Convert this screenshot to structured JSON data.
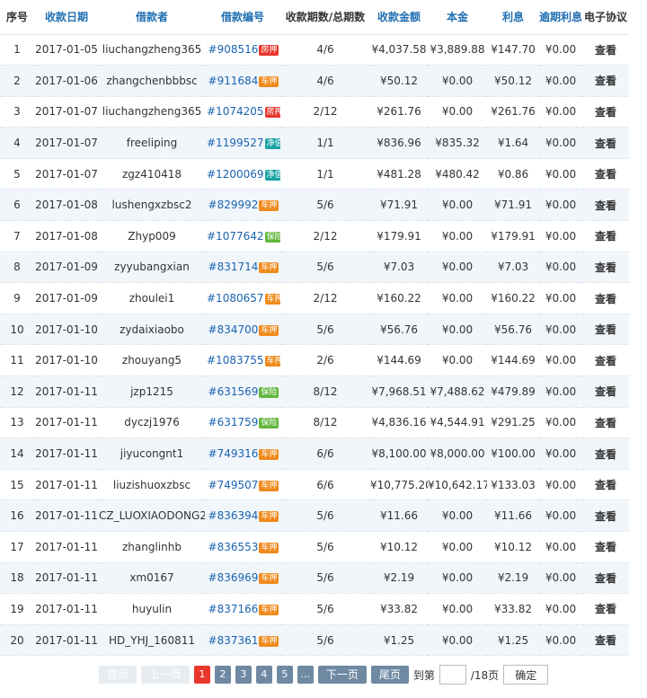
{
  "columns": [
    "序号",
    "收款日期",
    "借款者",
    "借款编号",
    "收款期数/总期数",
    "收款金额",
    "本金",
    "利息",
    "逾期利息",
    "电子协议"
  ],
  "colors": {
    "link_blue": "#1a63b0",
    "period_red": "#c0392b",
    "badge_car": "#f08a1c",
    "badge_house": "#e8382e",
    "badge_net": "#17a2a3",
    "badge_guarantee": "#62b63c"
  },
  "rows": [
    {
      "no": "1",
      "date": "2017-01-05",
      "user": "liuchangzheng365",
      "code": "#908516",
      "badge": "房押",
      "badge_color": "#e8382e",
      "period": "4/6",
      "amount": "¥4,037.58",
      "principal": "¥3,889.88",
      "interest": "¥147.70",
      "overdue": "¥0.00",
      "view": "查看"
    },
    {
      "no": "2",
      "date": "2017-01-06",
      "user": "zhangchenbbbsc",
      "code": "#911684",
      "badge": "车押",
      "badge_color": "#f08a1c",
      "period": "4/6",
      "amount": "¥50.12",
      "principal": "¥0.00",
      "interest": "¥50.12",
      "overdue": "¥0.00",
      "view": "查看"
    },
    {
      "no": "3",
      "date": "2017-01-07",
      "user": "liuchangzheng365",
      "code": "#1074205",
      "badge": "房押",
      "badge_color": "#e8382e",
      "period": "2/12",
      "amount": "¥261.76",
      "principal": "¥0.00",
      "interest": "¥261.76",
      "overdue": "¥0.00",
      "view": "查看"
    },
    {
      "no": "4",
      "date": "2017-01-07",
      "user": "freeliping",
      "code": "#1199527",
      "badge": "净值",
      "badge_color": "#17a2a3",
      "period": "1/1",
      "amount": "¥836.96",
      "principal": "¥835.32",
      "interest": "¥1.64",
      "overdue": "¥0.00",
      "view": "查看"
    },
    {
      "no": "5",
      "date": "2017-01-07",
      "user": "zgz410418",
      "code": "#1200069",
      "badge": "净值",
      "badge_color": "#17a2a3",
      "period": "1/1",
      "amount": "¥481.28",
      "principal": "¥480.42",
      "interest": "¥0.86",
      "overdue": "¥0.00",
      "view": "查看"
    },
    {
      "no": "6",
      "date": "2017-01-08",
      "user": "lushengxzbsc2",
      "code": "#829992",
      "badge": "车押",
      "badge_color": "#f08a1c",
      "period": "5/6",
      "amount": "¥71.91",
      "principal": "¥0.00",
      "interest": "¥71.91",
      "overdue": "¥0.00",
      "view": "查看"
    },
    {
      "no": "7",
      "date": "2017-01-08",
      "user": "Zhyp009",
      "code": "#1077642",
      "badge": "保险",
      "badge_color": "#62b63c",
      "period": "2/12",
      "amount": "¥179.91",
      "principal": "¥0.00",
      "interest": "¥179.91",
      "overdue": "¥0.00",
      "view": "查看"
    },
    {
      "no": "8",
      "date": "2017-01-09",
      "user": "zyyubangxian",
      "code": "#831714",
      "badge": "车押",
      "badge_color": "#f08a1c",
      "period": "5/6",
      "amount": "¥7.03",
      "principal": "¥0.00",
      "interest": "¥7.03",
      "overdue": "¥0.00",
      "view": "查看"
    },
    {
      "no": "9",
      "date": "2017-01-09",
      "user": "zhoulei1",
      "code": "#1080657",
      "badge": "车押",
      "badge_color": "#f08a1c",
      "period": "2/12",
      "amount": "¥160.22",
      "principal": "¥0.00",
      "interest": "¥160.22",
      "overdue": "¥0.00",
      "view": "查看"
    },
    {
      "no": "10",
      "date": "2017-01-10",
      "user": "zydaixiaobo",
      "code": "#834700",
      "badge": "车押",
      "badge_color": "#f08a1c",
      "period": "5/6",
      "amount": "¥56.76",
      "principal": "¥0.00",
      "interest": "¥56.76",
      "overdue": "¥0.00",
      "view": "查看"
    },
    {
      "no": "11",
      "date": "2017-01-10",
      "user": "zhouyang5",
      "code": "#1083755",
      "badge": "车押",
      "badge_color": "#f08a1c",
      "period": "2/6",
      "amount": "¥144.69",
      "principal": "¥0.00",
      "interest": "¥144.69",
      "overdue": "¥0.00",
      "view": "查看"
    },
    {
      "no": "12",
      "date": "2017-01-11",
      "user": "jzp1215",
      "code": "#631569",
      "badge": "保险",
      "badge_color": "#62b63c",
      "period": "8/12",
      "amount": "¥7,968.51",
      "principal": "¥7,488.62",
      "interest": "¥479.89",
      "overdue": "¥0.00",
      "view": "查看"
    },
    {
      "no": "13",
      "date": "2017-01-11",
      "user": "dyczj1976",
      "code": "#631759",
      "badge": "保险",
      "badge_color": "#62b63c",
      "period": "8/12",
      "amount": "¥4,836.16",
      "principal": "¥4,544.91",
      "interest": "¥291.25",
      "overdue": "¥0.00",
      "view": "查看"
    },
    {
      "no": "14",
      "date": "2017-01-11",
      "user": "jiyucongnt1",
      "code": "#749316",
      "badge": "车押",
      "badge_color": "#f08a1c",
      "period": "6/6",
      "amount": "¥8,100.00",
      "principal": "¥8,000.00",
      "interest": "¥100.00",
      "overdue": "¥0.00",
      "view": "查看"
    },
    {
      "no": "15",
      "date": "2017-01-11",
      "user": "liuzishuoxzbsc",
      "code": "#749507",
      "badge": "车押",
      "badge_color": "#f08a1c",
      "period": "6/6",
      "amount": "¥10,775.20",
      "principal": "¥10,642.17",
      "interest": "¥133.03",
      "overdue": "¥0.00",
      "view": "查看"
    },
    {
      "no": "16",
      "date": "2017-01-11",
      "user": "CZ_LUOXIAODONG2",
      "code": "#836394",
      "badge": "车押",
      "badge_color": "#f08a1c",
      "period": "5/6",
      "amount": "¥11.66",
      "principal": "¥0.00",
      "interest": "¥11.66",
      "overdue": "¥0.00",
      "view": "查看"
    },
    {
      "no": "17",
      "date": "2017-01-11",
      "user": "zhanglinhb",
      "code": "#836553",
      "badge": "车押",
      "badge_color": "#f08a1c",
      "period": "5/6",
      "amount": "¥10.12",
      "principal": "¥0.00",
      "interest": "¥10.12",
      "overdue": "¥0.00",
      "view": "查看"
    },
    {
      "no": "18",
      "date": "2017-01-11",
      "user": "xm0167",
      "code": "#836969",
      "badge": "车押",
      "badge_color": "#f08a1c",
      "period": "5/6",
      "amount": "¥2.19",
      "principal": "¥0.00",
      "interest": "¥2.19",
      "overdue": "¥0.00",
      "view": "查看"
    },
    {
      "no": "19",
      "date": "2017-01-11",
      "user": "huyulin",
      "code": "#837166",
      "badge": "车押",
      "badge_color": "#f08a1c",
      "period": "5/6",
      "amount": "¥33.82",
      "principal": "¥0.00",
      "interest": "¥33.82",
      "overdue": "¥0.00",
      "view": "查看"
    },
    {
      "no": "20",
      "date": "2017-01-11",
      "user": "HD_YHJ_160811",
      "code": "#837361",
      "badge": "车押",
      "badge_color": "#f08a1c",
      "period": "5/6",
      "amount": "¥1.25",
      "principal": "¥0.00",
      "interest": "¥1.25",
      "overdue": "¥0.00",
      "view": "查看"
    }
  ],
  "pager": {
    "first": "首页",
    "prev": "上一页",
    "pages": [
      "1",
      "2",
      "3",
      "4",
      "5",
      "..."
    ],
    "current": "1",
    "next": "下一页",
    "last": "尾页",
    "goto_prefix": "到第",
    "goto_suffix": "/18页",
    "confirm": "确定"
  }
}
